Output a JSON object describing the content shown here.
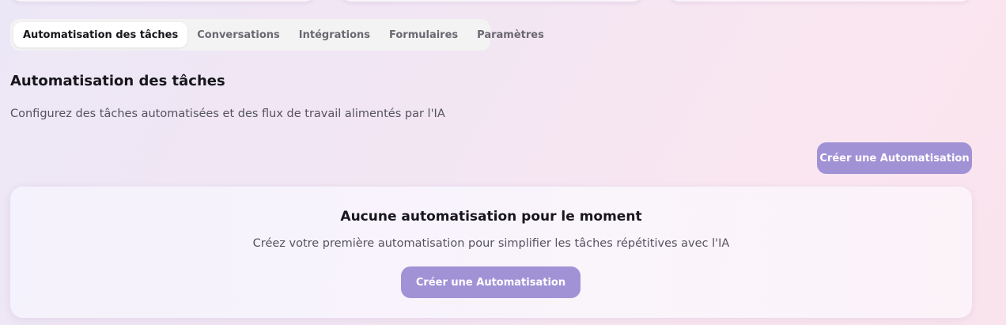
{
  "tabs": [
    {
      "label": "Automatisation des tâches",
      "active": true
    },
    {
      "label": "Conversations",
      "active": false
    },
    {
      "label": "Intégrations",
      "active": false
    },
    {
      "label": "Formulaires",
      "active": false
    },
    {
      "label": "Paramètres",
      "active": false
    }
  ],
  "section": {
    "title": "Automatisation des tâches",
    "subtitle": "Configurez des tâches automatisées et des flux de travail alimentés par l'IA",
    "create_button_label": "Créer une Automatisation"
  },
  "empty_state": {
    "title": "Aucune automatisation pour le moment",
    "description": "Créez votre première automatisation pour simplifier les tâches répétitives avec l'IA",
    "create_button_label": "Créer une Automatisation"
  },
  "colors": {
    "accent": "#a192d6",
    "tab_bar_bg": "#f4f3f3",
    "active_tab_bg": "#ffffff"
  }
}
